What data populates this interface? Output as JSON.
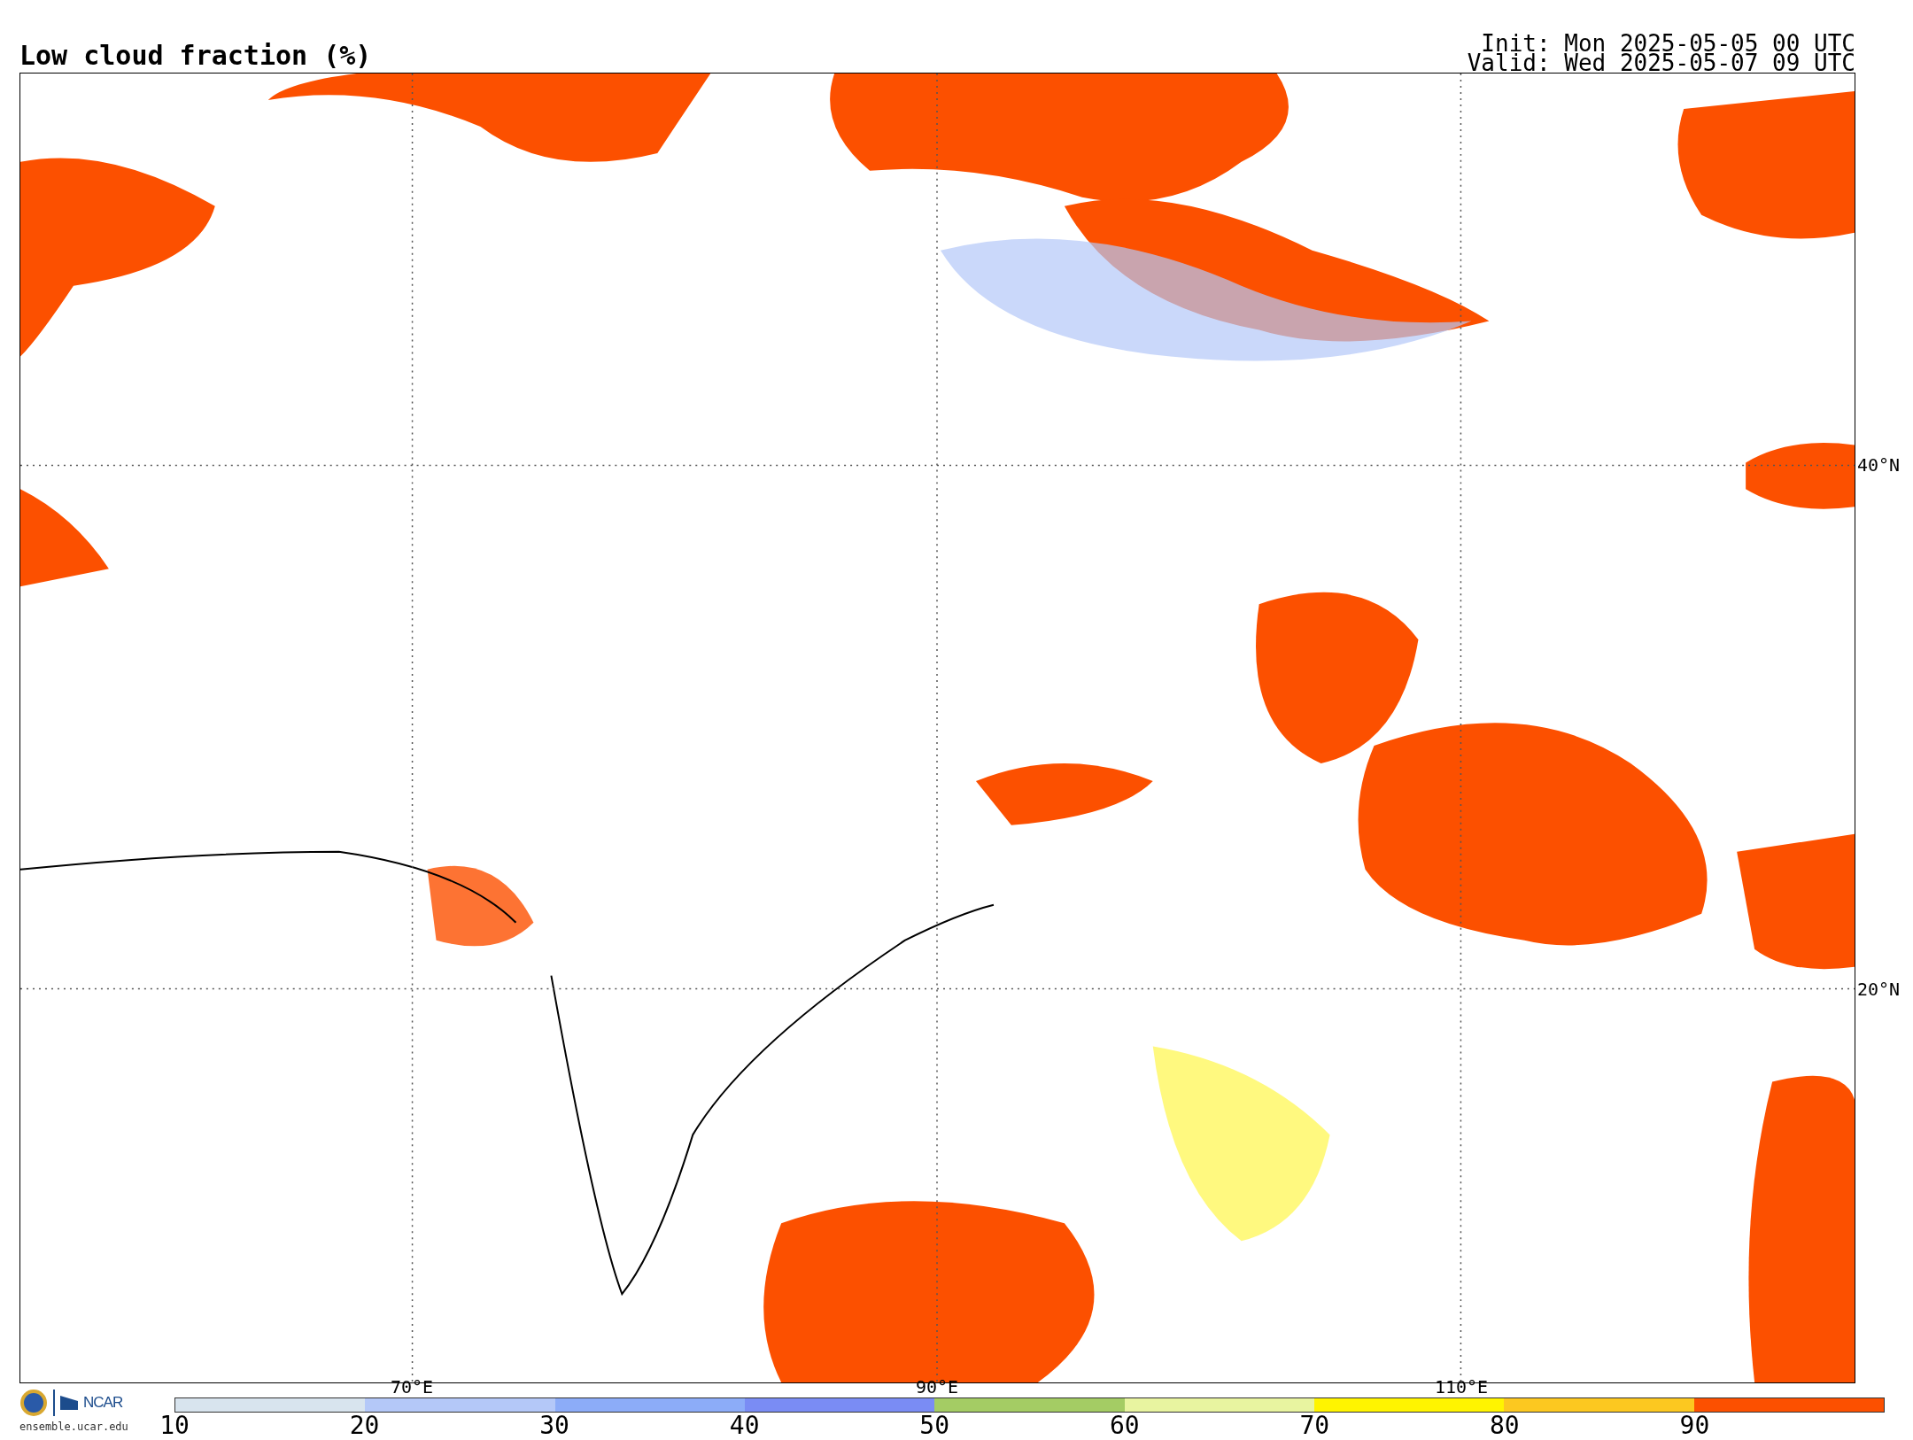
{
  "title": "Low cloud fraction (%)",
  "init": "Init: Mon 2025-05-05 00 UTC",
  "valid": "Valid: Wed 2025-05-07 09 UTC",
  "map": {
    "lon_labels": [
      "70°E",
      "90°E",
      "110°E"
    ],
    "lat_labels": [
      "40°N",
      "20°N"
    ]
  },
  "credits": {
    "org": "NCAR",
    "url": "ensemble.ucar.edu"
  },
  "colorbar": {
    "segments": [
      {
        "color": "#d8e4ee"
      },
      {
        "color": "#b4c8f8"
      },
      {
        "color": "#8cacf8"
      },
      {
        "color": "#7a8cf4"
      },
      {
        "color": "#a4cc64"
      },
      {
        "color": "#e8f4a0"
      },
      {
        "color": "#fff400"
      },
      {
        "color": "#fcc820"
      },
      {
        "color": "#fc5000"
      }
    ],
    "ticks": [
      "10",
      "20",
      "30",
      "40",
      "50",
      "60",
      "70",
      "80",
      "90"
    ]
  }
}
